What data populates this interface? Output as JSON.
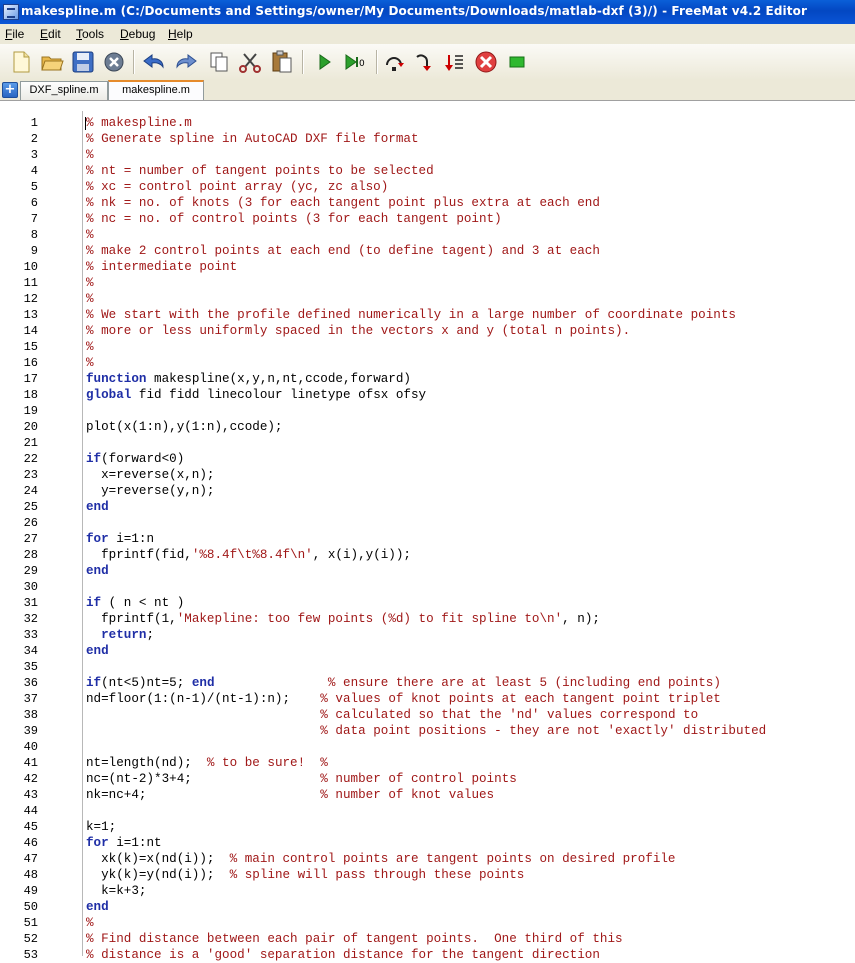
{
  "window": {
    "title": "makespline.m (C:/Documents and Settings/owner/My Documents/Downloads/matlab-dxf (3)/) - FreeMat v4.2 Editor"
  },
  "menu": [
    {
      "label": "File",
      "key": "F",
      "rest": "ile"
    },
    {
      "label": "Edit",
      "key": "E",
      "rest": "dit"
    },
    {
      "label": "Tools",
      "key": "T",
      "rest": "ools"
    },
    {
      "label": "Debug",
      "key": "D",
      "rest": "ebug"
    },
    {
      "label": "Help",
      "key": "H",
      "rest": "elp"
    }
  ],
  "toolbar": {
    "icons": [
      "new-file-icon",
      "open-folder-icon",
      "save-icon",
      "close-file-icon",
      "undo-icon",
      "redo-icon",
      "copy-icon",
      "cut-icon",
      "paste-icon",
      "run-icon",
      "run-to-cursor-icon",
      "step-over-icon",
      "step-into-icon",
      "step-out-icon",
      "stop-icon",
      "continue-icon"
    ]
  },
  "tabs": [
    {
      "label": "DXF_spline.m",
      "active": false
    },
    {
      "label": "makespline.m",
      "active": true
    }
  ],
  "editor": {
    "lines": [
      {
        "n": "1",
        "seg": [
          [
            "c",
            "% makespline.m"
          ]
        ]
      },
      {
        "n": "2",
        "seg": [
          [
            "c",
            "% Generate spline in AutoCAD DXF file format"
          ]
        ]
      },
      {
        "n": "3",
        "seg": [
          [
            "c",
            "%"
          ]
        ]
      },
      {
        "n": "4",
        "seg": [
          [
            "c",
            "% nt = number of tangent points to be selected"
          ]
        ]
      },
      {
        "n": "5",
        "seg": [
          [
            "c",
            "% xc = control point array (yc, zc also)"
          ]
        ]
      },
      {
        "n": "6",
        "seg": [
          [
            "c",
            "% nk = no. of knots (3 for each tangent point plus extra at each end"
          ]
        ]
      },
      {
        "n": "7",
        "seg": [
          [
            "c",
            "% nc = no. of control points (3 for each tangent point)"
          ]
        ]
      },
      {
        "n": "8",
        "seg": [
          [
            "c",
            "%"
          ]
        ]
      },
      {
        "n": "9",
        "seg": [
          [
            "c",
            "% make 2 control points at each end (to define tagent) and 3 at each"
          ]
        ]
      },
      {
        "n": "10",
        "seg": [
          [
            "c",
            "% intermediate point"
          ]
        ]
      },
      {
        "n": "11",
        "seg": [
          [
            "c",
            "%"
          ]
        ]
      },
      {
        "n": "12",
        "seg": [
          [
            "c",
            "%"
          ]
        ]
      },
      {
        "n": "13",
        "seg": [
          [
            "c",
            "% We start with the profile defined numerically in a large number of coordinate points"
          ]
        ]
      },
      {
        "n": "14",
        "seg": [
          [
            "c",
            "% more or less uniformly spaced in the vectors x and y (total n points)."
          ]
        ]
      },
      {
        "n": "15",
        "seg": [
          [
            "c",
            "%"
          ]
        ]
      },
      {
        "n": "16",
        "seg": [
          [
            "c",
            "%"
          ]
        ]
      },
      {
        "n": "17",
        "seg": [
          [
            "k",
            "function"
          ],
          [
            "t",
            " makespline(x,y,n,nt,ccode,forward)"
          ]
        ]
      },
      {
        "n": "18",
        "seg": [
          [
            "k",
            "global"
          ],
          [
            "t",
            " fid fidd linecolour linetype ofsx ofsy"
          ]
        ]
      },
      {
        "n": "19",
        "seg": []
      },
      {
        "n": "20",
        "seg": [
          [
            "t",
            "plot(x(1:n),y(1:n),ccode);"
          ]
        ]
      },
      {
        "n": "21",
        "seg": []
      },
      {
        "n": "22",
        "seg": [
          [
            "k",
            "if"
          ],
          [
            "t",
            "(forward<0)"
          ]
        ]
      },
      {
        "n": "23",
        "seg": [
          [
            "t",
            "  x=reverse(x,n);"
          ]
        ]
      },
      {
        "n": "24",
        "seg": [
          [
            "t",
            "  y=reverse(y,n);"
          ]
        ]
      },
      {
        "n": "25",
        "seg": [
          [
            "k",
            "end"
          ]
        ]
      },
      {
        "n": "26",
        "seg": []
      },
      {
        "n": "27",
        "seg": [
          [
            "k",
            "for"
          ],
          [
            "t",
            " i=1:n"
          ]
        ]
      },
      {
        "n": "28",
        "seg": [
          [
            "t",
            "  fprintf(fid,"
          ],
          [
            "s",
            "'%8.4f\\t%8.4f\\n'"
          ],
          [
            "t",
            ", x(i),y(i));"
          ]
        ]
      },
      {
        "n": "29",
        "seg": [
          [
            "k",
            "end"
          ]
        ]
      },
      {
        "n": "30",
        "seg": []
      },
      {
        "n": "31",
        "seg": [
          [
            "k",
            "if"
          ],
          [
            "t",
            " ( n < nt )"
          ]
        ]
      },
      {
        "n": "32",
        "seg": [
          [
            "t",
            "  fprintf(1,"
          ],
          [
            "s",
            "'Makepline: too few points (%d) to fit spline to\\n'"
          ],
          [
            "t",
            ", n);"
          ]
        ]
      },
      {
        "n": "33",
        "seg": [
          [
            "k",
            "  return"
          ],
          [
            "t",
            ";"
          ]
        ]
      },
      {
        "n": "34",
        "seg": [
          [
            "k",
            "end"
          ]
        ]
      },
      {
        "n": "35",
        "seg": []
      },
      {
        "n": "36",
        "seg": [
          [
            "k",
            "if"
          ],
          [
            "t",
            "(nt<5)nt=5; "
          ],
          [
            "k",
            "end"
          ],
          [
            "t",
            "               "
          ],
          [
            "c",
            "% ensure there are at least 5 (including end points)"
          ]
        ]
      },
      {
        "n": "37",
        "seg": [
          [
            "t",
            "nd=floor(1:(n-1)/(nt-1):n);    "
          ],
          [
            "c",
            "% values of knot points at each tangent point triplet"
          ]
        ]
      },
      {
        "n": "38",
        "seg": [
          [
            "t",
            "                               "
          ],
          [
            "c",
            "% calculated so that the 'nd' values correspond to"
          ]
        ]
      },
      {
        "n": "39",
        "seg": [
          [
            "t",
            "                               "
          ],
          [
            "c",
            "% data point positions - they are not 'exactly' distributed"
          ]
        ]
      },
      {
        "n": "40",
        "seg": []
      },
      {
        "n": "41",
        "seg": [
          [
            "t",
            "nt=length(nd);  "
          ],
          [
            "c",
            "% to be sure!  %"
          ]
        ]
      },
      {
        "n": "42",
        "seg": [
          [
            "t",
            "nc=(nt-2)*3+4;                 "
          ],
          [
            "c",
            "% number of control points"
          ]
        ]
      },
      {
        "n": "43",
        "seg": [
          [
            "t",
            "nk=nc+4;                       "
          ],
          [
            "c",
            "% number of knot values"
          ]
        ]
      },
      {
        "n": "44",
        "seg": []
      },
      {
        "n": "45",
        "seg": [
          [
            "t",
            "k=1;"
          ]
        ]
      },
      {
        "n": "46",
        "seg": [
          [
            "k",
            "for"
          ],
          [
            "t",
            " i=1:nt"
          ]
        ]
      },
      {
        "n": "47",
        "seg": [
          [
            "t",
            "  xk(k)=x(nd(i));  "
          ],
          [
            "c",
            "% main control points are tangent points on desired profile"
          ]
        ]
      },
      {
        "n": "48",
        "seg": [
          [
            "t",
            "  yk(k)=y(nd(i));  "
          ],
          [
            "c",
            "% spline will pass through these points"
          ]
        ]
      },
      {
        "n": "49",
        "seg": [
          [
            "t",
            "  k=k+3;"
          ]
        ]
      },
      {
        "n": "50",
        "seg": [
          [
            "k",
            "end"
          ]
        ]
      },
      {
        "n": "51",
        "seg": [
          [
            "c",
            "%"
          ]
        ]
      },
      {
        "n": "52",
        "seg": [
          [
            "c",
            "% Find distance between each pair of tangent points.  One third of this"
          ]
        ]
      },
      {
        "n": "53",
        "seg": [
          [
            "c",
            "% distance is a 'good' separation distance for the tangent direction"
          ]
        ]
      }
    ]
  }
}
